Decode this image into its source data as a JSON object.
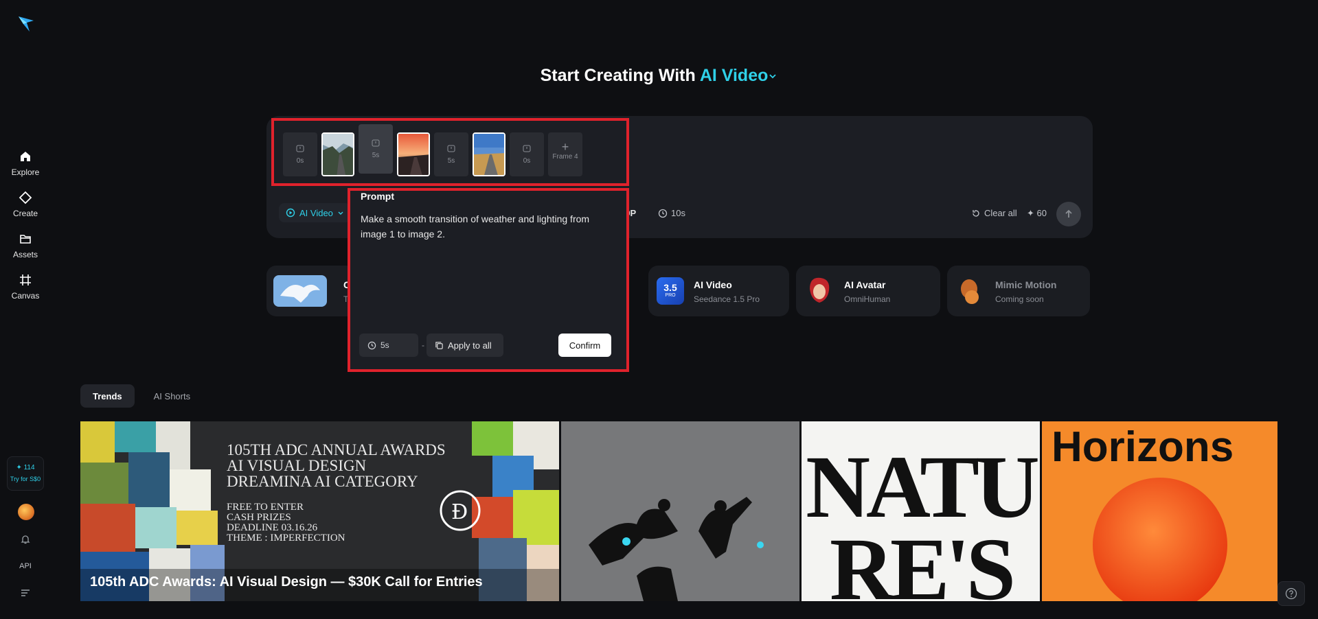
{
  "sidebar": {
    "nav": [
      {
        "label": "Explore",
        "icon": "home-icon"
      },
      {
        "label": "Create",
        "icon": "create-icon"
      },
      {
        "label": "Assets",
        "icon": "folder-icon"
      },
      {
        "label": "Canvas",
        "icon": "canvas-icon"
      }
    ],
    "credits": {
      "amount": "✦ 114",
      "offer": "Try for S$0"
    },
    "api_label": "API"
  },
  "heading": {
    "prefix": "Start Creating With",
    "mode": "AI Video"
  },
  "composer": {
    "frames": [
      {
        "type": "duration",
        "label": "0s"
      },
      {
        "type": "image",
        "name": "mountain-road"
      },
      {
        "type": "duration",
        "label": "5s",
        "active": true
      },
      {
        "type": "image",
        "name": "sunset-road"
      },
      {
        "type": "duration",
        "label": "5s"
      },
      {
        "type": "image",
        "name": "desert-road"
      },
      {
        "type": "duration",
        "label": "0s"
      },
      {
        "type": "add",
        "label": "Frame 4"
      }
    ],
    "mode_label": "AI Video",
    "resolution_label": "20P",
    "duration_label": "10s",
    "clear_label": "Clear all",
    "cost_label": "✦ 60"
  },
  "popup": {
    "title": "Prompt",
    "text": "Make a smooth transition of weather and lighting from image 1 to image 2.",
    "duration": "5s",
    "apply_label": "Apply to all",
    "confirm_label": "Confirm"
  },
  "features": [
    {
      "title": "C",
      "subtitle": "T"
    },
    {
      "title": "AI Video",
      "subtitle": "Seedance 1.5 Pro",
      "badge": "3.5",
      "badge_sub": "PRO"
    },
    {
      "title": "AI Avatar",
      "subtitle": "OmniHuman"
    },
    {
      "title": "Mimic Motion",
      "subtitle": "Coming soon"
    }
  ],
  "tabs": [
    {
      "label": "Trends",
      "active": true
    },
    {
      "label": "AI Shorts",
      "active": false
    }
  ],
  "gallery": {
    "banner": {
      "lines": [
        "105TH ADC ANNUAL AWARDS",
        "AI VISUAL DESIGN",
        "DREAMINA AI CATEGORY"
      ],
      "details": [
        "FREE TO ENTER",
        "CASH PRIZES",
        "DEADLINE 03.16.26",
        "THEME : IMPERFECTION"
      ],
      "caption": "105th ADC Awards: AI Visual Design — $30K Call for Entries"
    },
    "tile_nature_text": "NATU RE'S",
    "tile_horizons_text": "Horizons"
  },
  "colors": {
    "accent": "#2fd0e8",
    "highlight": "#e0222c",
    "background": "#0e0f12"
  }
}
